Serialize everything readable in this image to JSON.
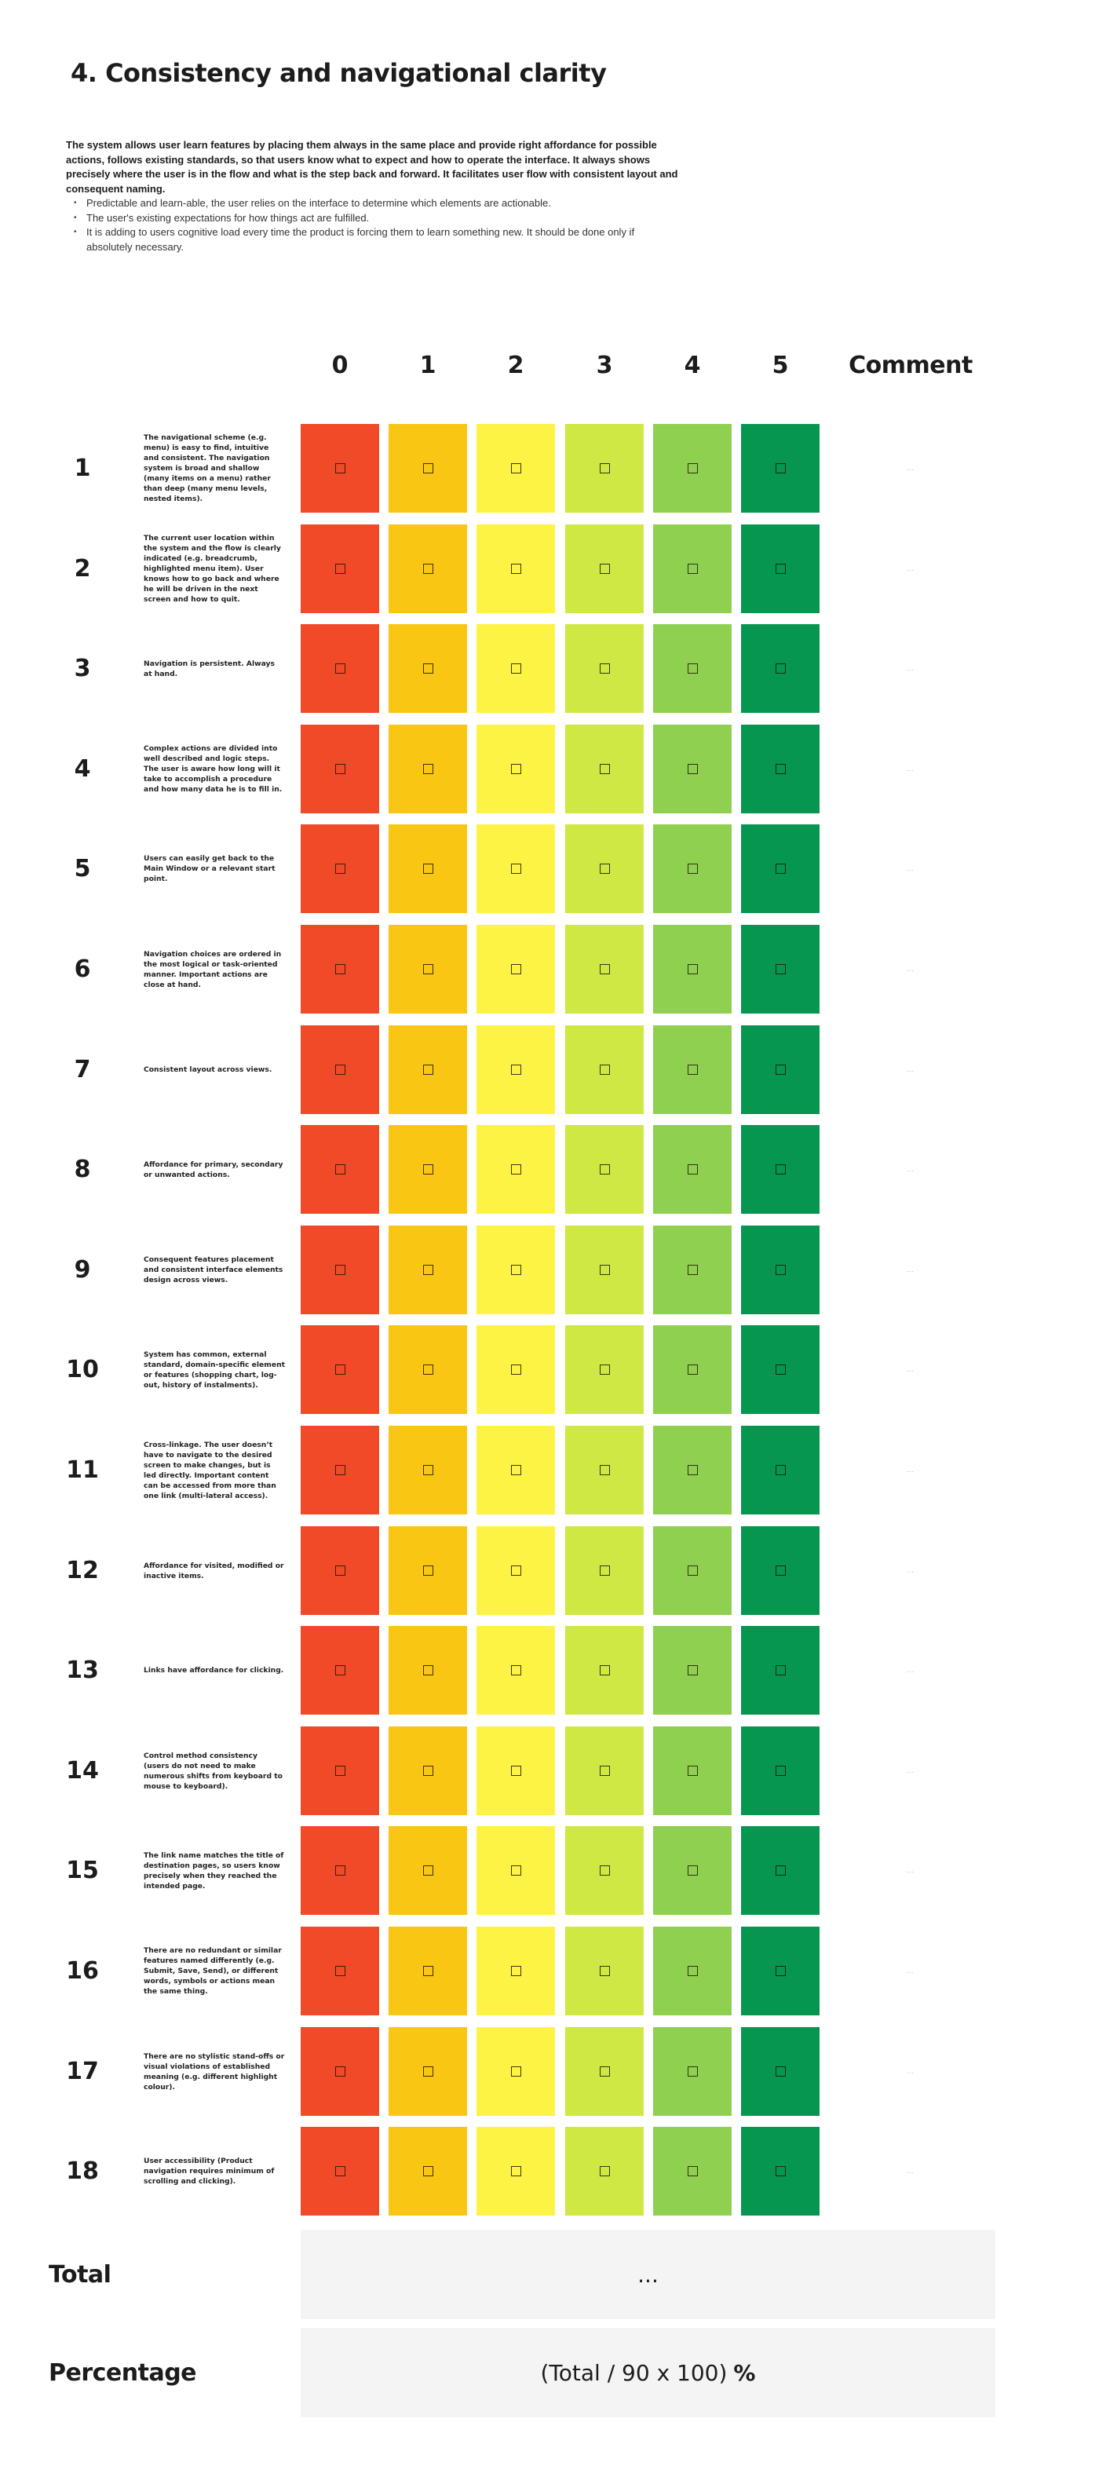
{
  "title": "4. Consistency and navigational clarity",
  "intro": {
    "lead": "The system allows user learn features by placing them always in the same place and provide right affordance for possible actions, follows existing standards, so that users know what to expect and how to operate the interface. It always shows precisely where the user is in the flow and what is the step back and forward. It facilitates user flow with consistent layout and consequent naming.",
    "bullets": [
      "Predictable and learn-able, the user relies on the interface to determine which elements are actionable.",
      "The user's existing expectations for how things act are fulfilled.",
      "It is adding to users cognitive load every time the product is forcing them to learn something new. It should be done only if absolutely necessary."
    ]
  },
  "columns": {
    "scores": [
      "0",
      "1",
      "2",
      "3",
      "4",
      "5"
    ],
    "comment": "Comment"
  },
  "score_colors": [
    "#f04a28",
    "#f9c614",
    "#fdf345",
    "#cfe844",
    "#90d050",
    "#07964f"
  ],
  "checkbox_icon": "empty-checkbox",
  "comment_placeholder": "...",
  "criteria": [
    {
      "num": "1",
      "text": "The navigational scheme (e.g. menu) is easy to find, intuitive and consistent. The navigation system is broad and shallow (many items on a menu) rather than deep (many menu levels, nested items)."
    },
    {
      "num": "2",
      "text": "The current user location within the system and the flow is clearly indicated (e.g. breadcrumb, highlighted menu item). User knows how to go back and where he will be driven in the next screen and how to quit."
    },
    {
      "num": "3",
      "text": "Navigation is persistent. Always at hand."
    },
    {
      "num": "4",
      "text": "Complex actions are divided into well described and logic steps. The user is aware how long will it take to accomplish a procedure and how many data he is to fill in."
    },
    {
      "num": "5",
      "text": "Users can easily get back to the Main Window or a relevant start point."
    },
    {
      "num": "6",
      "text": "Navigation choices are ordered in the most logical or task-oriented manner. Important actions are close at hand."
    },
    {
      "num": "7",
      "text": "Consistent layout across views."
    },
    {
      "num": "8",
      "text": "Affordance for primary, secondary or unwanted actions."
    },
    {
      "num": "9",
      "text": "Consequent features placement and consistent interface elements design across views."
    },
    {
      "num": "10",
      "text": "System has common, external standard, domain-specific element or features (shopping chart, log-out, history of instalments)."
    },
    {
      "num": "11",
      "text": "Cross-linkage. The user doesn’t have to navigate to the desired screen to make changes, but is led directly. Important content can be accessed from more than one link (multi-lateral access)."
    },
    {
      "num": "12",
      "text": "Affordance for visited, modified or inactive items."
    },
    {
      "num": "13",
      "text": "Links have affordance for clicking."
    },
    {
      "num": "14",
      "text": "Control method consistency (users do not need to make numerous shifts from keyboard to mouse to keyboard)."
    },
    {
      "num": "15",
      "text": "The link name matches the title of destination pages, so users know precisely when they reached the intended page."
    },
    {
      "num": "16",
      "text": "There are no redundant or similar features named differently (e.g. Submit, Save, Send), or different words, symbols or actions mean the same thing."
    },
    {
      "num": "17",
      "text": "There are no stylistic stand-offs or visual violations of established meaning (e.g. different highlight colour)."
    },
    {
      "num": "18",
      "text": "User accessibility (Product navigation requires minimum of scrolling and clicking)."
    }
  ],
  "summary": {
    "total_label": "Total",
    "total_value": "...",
    "percentage_label": "Percentage",
    "percentage_formula": "(Total / 90 x 100)",
    "percentage_sign": "%"
  }
}
